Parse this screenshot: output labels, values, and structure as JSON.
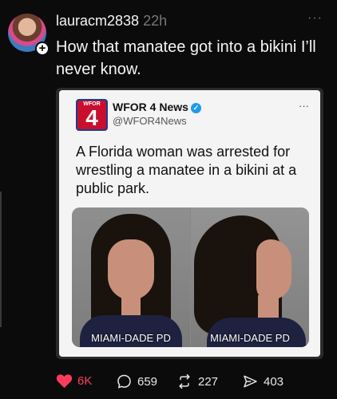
{
  "post": {
    "username": "lauracm2838",
    "time": "22h",
    "more": "···",
    "follow_symbol": "+",
    "text": "How that manatee got into a bikini I’ll never know."
  },
  "embed": {
    "logo_top": "WFOR",
    "logo_number": "4",
    "account_name": "WFOR 4 News",
    "verified_symbol": "✓",
    "handle": "@WFOR4News",
    "more": "···",
    "text": "A Florida woman was arrested for wrestling a manatee in a bikini at a public park.",
    "photo_captions": [
      "MIAMI-DADE PD",
      "MIAMI-DADE PD"
    ]
  },
  "actions": {
    "likes": "6K",
    "replies": "659",
    "reposts": "227",
    "shares": "403"
  },
  "colors": {
    "like": "#ff3b5c",
    "background": "#0b0b0b"
  }
}
